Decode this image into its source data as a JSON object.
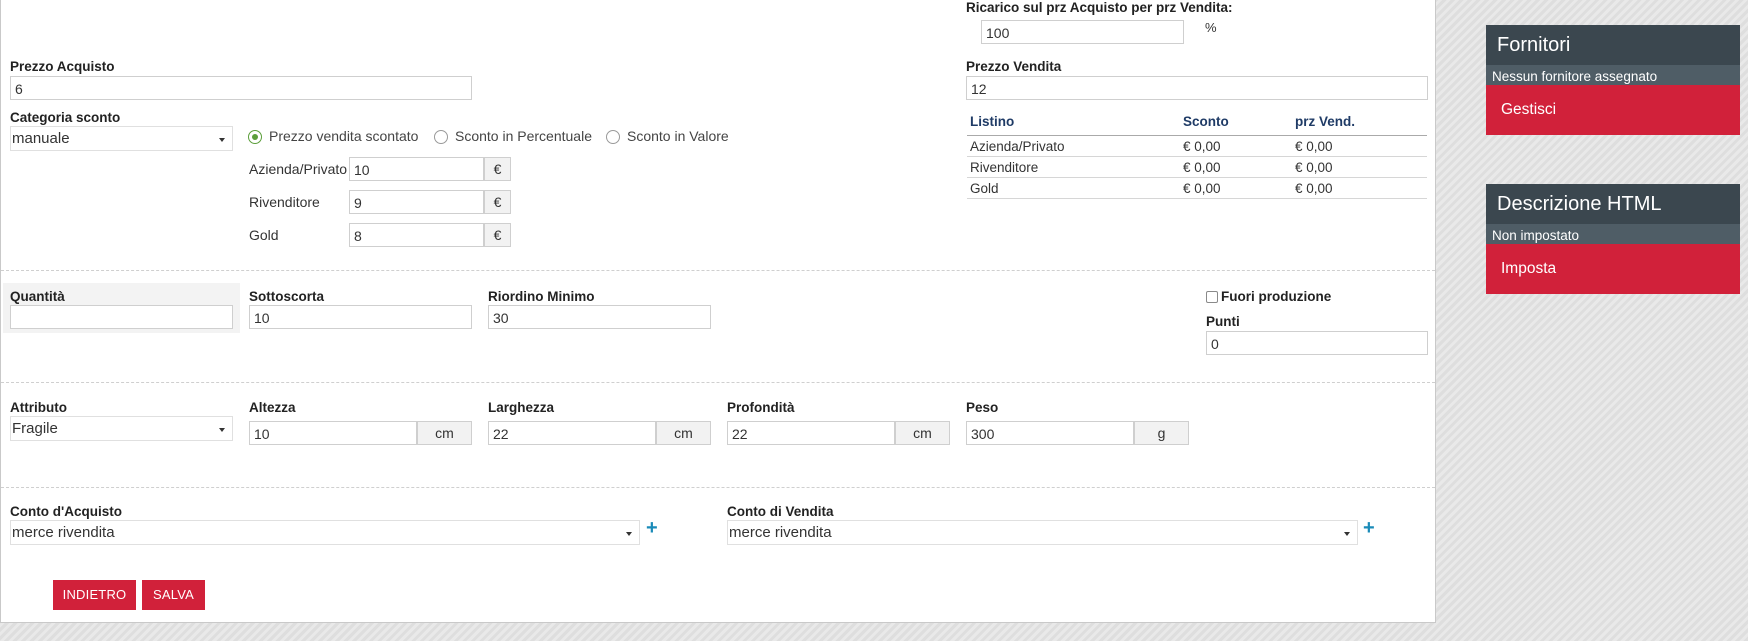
{
  "pricing": {
    "markup_label": "Ricarico sul prz Acquisto per prz Vendita:",
    "markup_value": "100",
    "markup_unit": "%",
    "purchase_label": "Prezzo Acquisto",
    "purchase_value": "6",
    "sale_label": "Prezzo Vendita",
    "sale_value": "12",
    "discount_category_label": "Categoria sconto",
    "discount_category_value": "manuale",
    "discount_modes": [
      {
        "label": "Prezzo vendita scontato",
        "selected": true
      },
      {
        "label": "Sconto in Percentuale",
        "selected": false
      },
      {
        "label": "Sconto in Valore",
        "selected": false
      }
    ],
    "discount_rows": [
      {
        "label": "Azienda/Privato",
        "value": "10",
        "unit": "€"
      },
      {
        "label": "Rivenditore",
        "value": "9",
        "unit": "€"
      },
      {
        "label": "Gold",
        "value": "8",
        "unit": "€"
      }
    ]
  },
  "price_list": {
    "headers": [
      "Listino",
      "Sconto",
      "prz Vend."
    ],
    "rows": [
      [
        "Azienda/Privato",
        "€ 0,00",
        "€ 0,00"
      ],
      [
        "Rivenditore",
        "€ 0,00",
        "€ 0,00"
      ],
      [
        "Gold",
        "€ 0,00",
        "€ 0,00"
      ]
    ]
  },
  "stock": {
    "quantity_label": "Quantità",
    "quantity_value": "",
    "safety_label": "Sottoscorta",
    "safety_value": "10",
    "reorder_label": "Riordino Minimo",
    "reorder_value": "30",
    "discontinued_label": "Fuori produzione",
    "discontinued_checked": false,
    "points_label": "Punti",
    "points_value": "0"
  },
  "dimensions": {
    "attribute_label": "Attributo",
    "attribute_value": "Fragile",
    "height_label": "Altezza",
    "height_value": "10",
    "height_unit": "cm",
    "width_label": "Larghezza",
    "width_value": "22",
    "width_unit": "cm",
    "depth_label": "Profondità",
    "depth_value": "22",
    "depth_unit": "cm",
    "weight_label": "Peso",
    "weight_value": "300",
    "weight_unit": "g"
  },
  "accounts": {
    "purchase_label": "Conto d'Acquisto",
    "purchase_value": "merce rivendita",
    "sale_label": "Conto di Vendita",
    "sale_value": "merce rivendita"
  },
  "actions": {
    "back_label": "INDIETRO",
    "save_label": "SALVA"
  },
  "sidebar": {
    "suppliers": {
      "title": "Fornitori",
      "status": "Nessun fornitore assegnato",
      "action": "Gestisci"
    },
    "html_desc": {
      "title": "Descrizione HTML",
      "status": "Non impostato",
      "action": "Imposta"
    }
  },
  "colors": {
    "accent": "#d1213a",
    "panel_dark": "#3b474f",
    "link_blue": "#1a8bb8",
    "radio_green": "#5b9e3a"
  }
}
